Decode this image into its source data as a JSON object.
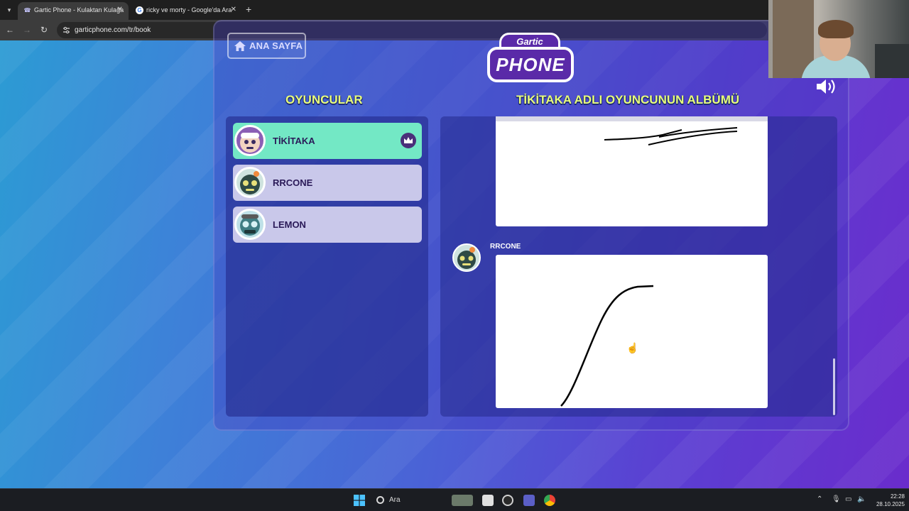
{
  "browser": {
    "tabs": [
      {
        "title": "Gartic Phone - Kulaktan Kulağa",
        "active": true
      },
      {
        "title": "ricky ve morty - Google'da Ara",
        "active": false
      }
    ],
    "url": "garticphone.com/tr/book"
  },
  "page": {
    "home_button": "ANA SAYFA",
    "logo": {
      "top": "Gartic",
      "main": "PHONE"
    },
    "players_heading": "OYUNCULAR",
    "album_heading": "TİKİTAKA ADLI OYUNCUNUN ALBÜMÜ",
    "players": [
      {
        "name": "TİKİTAKA",
        "host": true
      },
      {
        "name": "RRCONE",
        "host": false
      },
      {
        "name": "LEMON",
        "host": false
      }
    ],
    "album": {
      "entry_author": "RRCONE"
    }
  },
  "colors": {
    "host_row": "#73e8c5",
    "player_row": "#c9c8ea",
    "heading": "#e9ff7a",
    "background_start": "#2c9bd4",
    "background_end": "#6a2ccc"
  },
  "taskbar": {
    "search_label": "Ara",
    "time": "22:28",
    "date": "28.10.2025"
  }
}
